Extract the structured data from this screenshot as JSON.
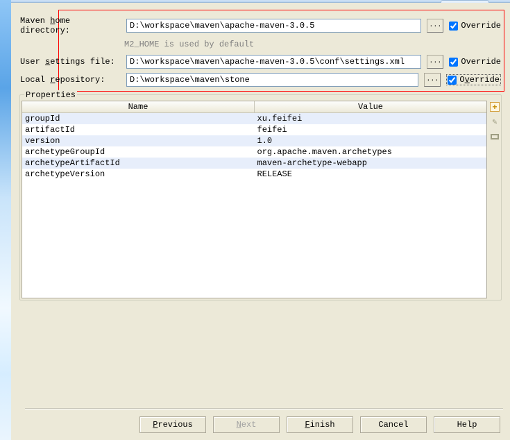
{
  "fields": {
    "maven_home": {
      "label_pre": "Maven ",
      "label_u": "h",
      "label_post": "ome directory:",
      "value": "D:\\workspace\\maven\\apache-maven-3.0.5",
      "help": "M2_HOME is used by default",
      "override": "Override"
    },
    "user_settings": {
      "label_pre": "User ",
      "label_u": "s",
      "label_post": "ettings file:",
      "value": "D:\\workspace\\maven\\apache-maven-3.0.5\\conf\\settings.xml",
      "override": "Override"
    },
    "local_repo": {
      "label_pre": "Local ",
      "label_u": "r",
      "label_post": "epository:",
      "value": "D:\\workspace\\maven\\stone",
      "override_pre": "O",
      "override_u": "v",
      "override_post": "erride"
    }
  },
  "properties": {
    "legend": "Properties",
    "name_header": "Name",
    "value_header": "Value",
    "rows": [
      {
        "name": "groupId",
        "value": "xu.feifei"
      },
      {
        "name": "artifactId",
        "value": "feifei"
      },
      {
        "name": "version",
        "value": "1.0"
      },
      {
        "name": "archetypeGroupId",
        "value": "org.apache.maven.archetypes"
      },
      {
        "name": "archetypeArtifactId",
        "value": "maven-archetype-webapp"
      },
      {
        "name": "archetypeVersion",
        "value": "RELEASE"
      }
    ]
  },
  "buttons": {
    "previous_u": "P",
    "previous_post": "revious",
    "next_u": "N",
    "next_post": "ext",
    "finish_u": "F",
    "finish_post": "inish",
    "cancel": "Cancel",
    "help": "Help"
  },
  "browse_label": "..."
}
